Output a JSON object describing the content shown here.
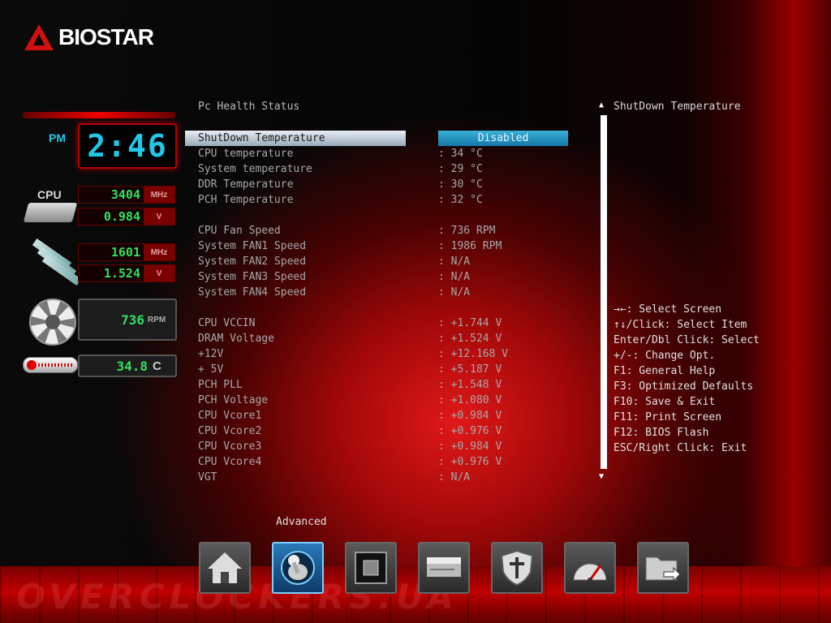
{
  "brand": {
    "name": "BIOSTAR"
  },
  "clock": {
    "ampm": "PM",
    "time": "2:46"
  },
  "monitors": {
    "cpu_label": "CPU",
    "cpu_freq": "3404",
    "cpu_freq_unit": "MHz",
    "cpu_volt": "0.984",
    "cpu_volt_unit": "V",
    "mem_freq": "1601",
    "mem_freq_unit": "MHz",
    "mem_volt": "1.524",
    "mem_volt_unit": "V",
    "fan_rpm": "736",
    "fan_unit": "RPM",
    "temp": "34.8",
    "temp_unit": "C"
  },
  "page": {
    "title": "Pc Health Status",
    "rows": [
      {
        "label": "ShutDown Temperature",
        "value": "Disabled",
        "selected": true
      },
      {
        "label": "CPU temperature",
        "value": ": 34 °C"
      },
      {
        "label": "System temperature",
        "value": ": 29 °C"
      },
      {
        "label": "DDR Temperature",
        "value": ": 30 °C"
      },
      {
        "label": "PCH Temperature",
        "value": ": 32 °C"
      },
      {
        "label": "CPU Fan Speed",
        "value": ": 736 RPM"
      },
      {
        "label": "System FAN1 Speed",
        "value": ": 1986 RPM"
      },
      {
        "label": "System FAN2 Speed",
        "value": ": N/A"
      },
      {
        "label": "System FAN3 Speed",
        "value": ": N/A"
      },
      {
        "label": "System FAN4 Speed",
        "value": ": N/A"
      },
      {
        "label": "CPU VCCIN",
        "value": ": +1.744 V"
      },
      {
        "label": "DRAM Voltage",
        "value": ": +1.524 V"
      },
      {
        "label": "+12V",
        "value": ": +12.168 V"
      },
      {
        "label": "+ 5V",
        "value": ": +5.187 V"
      },
      {
        "label": "PCH PLL",
        "value": ": +1.548 V"
      },
      {
        "label": "PCH Voltage",
        "value": ": +1.080 V"
      },
      {
        "label": "CPU Vcore1",
        "value": ": +0.984 V"
      },
      {
        "label": "CPU Vcore2",
        "value": ": +0.976 V"
      },
      {
        "label": "CPU Vcore3",
        "value": ": +0.984 V"
      },
      {
        "label": "CPU Vcore4",
        "value": ": +0.976 V"
      },
      {
        "label": "VGT",
        "value": ": N/A"
      }
    ]
  },
  "help": {
    "title": "ShutDown Temperature",
    "keys": [
      "→←: Select Screen",
      "↑↓/Click: Select Item",
      "Enter/Dbl Click: Select",
      "+/-: Change Opt.",
      "F1: General Help",
      "F3: Optimized Defaults",
      "F10: Save & Exit",
      "F11: Print Screen",
      "F12: BIOS Flash",
      "ESC/Right Click: Exit"
    ]
  },
  "nav": {
    "active_label": "Advanced",
    "items": [
      {
        "icon": "home-icon"
      },
      {
        "icon": "joystick-icon",
        "active": true
      },
      {
        "icon": "chipset-icon"
      },
      {
        "icon": "boot-drive-icon"
      },
      {
        "icon": "security-shield-icon"
      },
      {
        "icon": "speedometer-icon"
      },
      {
        "icon": "exit-folder-icon"
      }
    ]
  },
  "watermark": "OVERCLOCKERS.UA"
}
